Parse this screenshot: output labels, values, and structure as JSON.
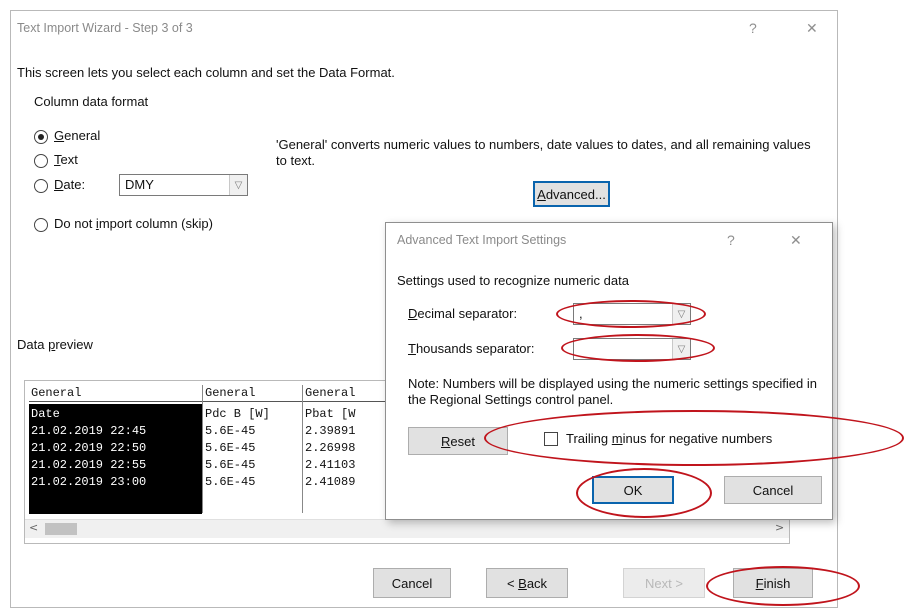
{
  "wizard": {
    "title": "Text Import Wizard - Step 3 of 3",
    "help_glyph": "?",
    "close_glyph": "✕",
    "intro": "This screen lets you select each column and set the Data Format.",
    "column_format_heading": "Column data format",
    "options": {
      "general": {
        "pre": "",
        "ul": "G",
        "post": "eneral"
      },
      "text": {
        "pre": "",
        "ul": "T",
        "post": "ext"
      },
      "date": {
        "pre": "",
        "ul": "D",
        "post": "ate:"
      },
      "skip": {
        "pre": "Do not ",
        "ul": "i",
        "post": "mport column (skip)"
      }
    },
    "selected_option": "general",
    "date_format_value": "DMY",
    "description": "'General' converts numeric values to numbers, date values to dates, and all remaining values to text.",
    "advanced_button": {
      "pre": "",
      "ul": "A",
      "post": "dvanced..."
    },
    "data_preview_label": {
      "pre": "Data ",
      "ul": "p",
      "post": "review"
    },
    "buttons": {
      "cancel": "Cancel",
      "back": {
        "pre": "< ",
        "ul": "B",
        "post": "ack"
      },
      "next": "Next >",
      "finish": {
        "pre": "",
        "ul": "F",
        "post": "inish"
      }
    }
  },
  "preview": {
    "headers": [
      "General",
      "General",
      "General"
    ],
    "rows": [
      [
        "Date",
        "Pdc B [W]",
        "Pbat [W"
      ],
      [
        "21.02.2019 22:45",
        "5.6E-45",
        "2.39891"
      ],
      [
        "21.02.2019 22:50",
        "5.6E-45",
        "2.26998"
      ],
      [
        "21.02.2019 22:55",
        "5.6E-45",
        "2.41103"
      ],
      [
        "21.02.2019 23:00",
        "5.6E-45",
        "2.41089"
      ]
    ],
    "scroll_left": "<",
    "scroll_right": ">"
  },
  "advanced": {
    "title": "Advanced Text Import Settings",
    "help_glyph": "?",
    "close_glyph": "✕",
    "heading": "Settings used to recognize numeric data",
    "decimal_label": {
      "pre": "",
      "ul": "D",
      "post": "ecimal separator:"
    },
    "decimal_value": ",",
    "thousands_label": {
      "pre": "",
      "ul": "T",
      "post": "housands separator:"
    },
    "thousands_value": "",
    "note": "Note: Numbers will be displayed using the numeric settings specified in the Regional Settings control panel.",
    "reset": {
      "pre": "",
      "ul": "R",
      "post": "eset"
    },
    "trailing_minus": {
      "pre": "Trailing ",
      "ul": "m",
      "post": "inus for negative numbers"
    },
    "trailing_minus_checked": false,
    "ok": "OK",
    "cancel": "Cancel"
  },
  "colors": {
    "annotation": "#c0141c",
    "focus_border": "#0a64ad"
  }
}
